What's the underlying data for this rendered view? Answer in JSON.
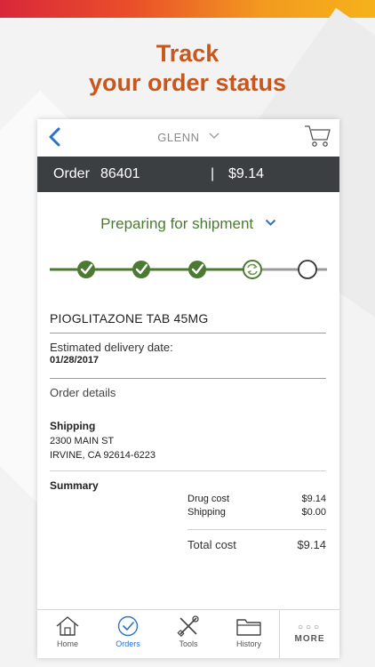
{
  "headline": {
    "line1": "Track",
    "line2": "your order status"
  },
  "nav": {
    "user_name": "GLENN"
  },
  "order": {
    "label": "Order",
    "number": "86401",
    "separator": "|",
    "price": "$9.14"
  },
  "status": {
    "text": "Preparing for shipment",
    "steps_completed": 3,
    "step_in_progress": 4,
    "total_steps": 5
  },
  "item": {
    "drug_name": "PIOGLITAZONE TAB 45MG"
  },
  "delivery": {
    "label": "Estimated delivery date:",
    "date": "01/28/2017"
  },
  "details_link": "Order details",
  "shipping": {
    "title": "Shipping",
    "address_line1": "2300 MAIN ST",
    "address_line2": "IRVINE, CA 92614-6223"
  },
  "summary": {
    "title": "Summary",
    "rows": [
      {
        "label": "Drug cost",
        "value": "$9.14"
      },
      {
        "label": "Shipping",
        "value": "$0.00"
      }
    ],
    "total_label": "Total cost",
    "total_value": "$9.14"
  },
  "tabs": [
    {
      "label": "Home",
      "icon": "home-icon"
    },
    {
      "label": "Orders",
      "icon": "orders-check-icon",
      "active": true
    },
    {
      "label": "Tools",
      "icon": "tools-icon"
    },
    {
      "label": "History",
      "icon": "folder-icon"
    },
    {
      "label": "MORE",
      "icon": "more-dots-icon"
    }
  ],
  "colors": {
    "brand_orange": "#c8571d",
    "status_green": "#4c7a33",
    "accent_blue": "#2a73c5",
    "order_bar": "#3c3f42"
  }
}
